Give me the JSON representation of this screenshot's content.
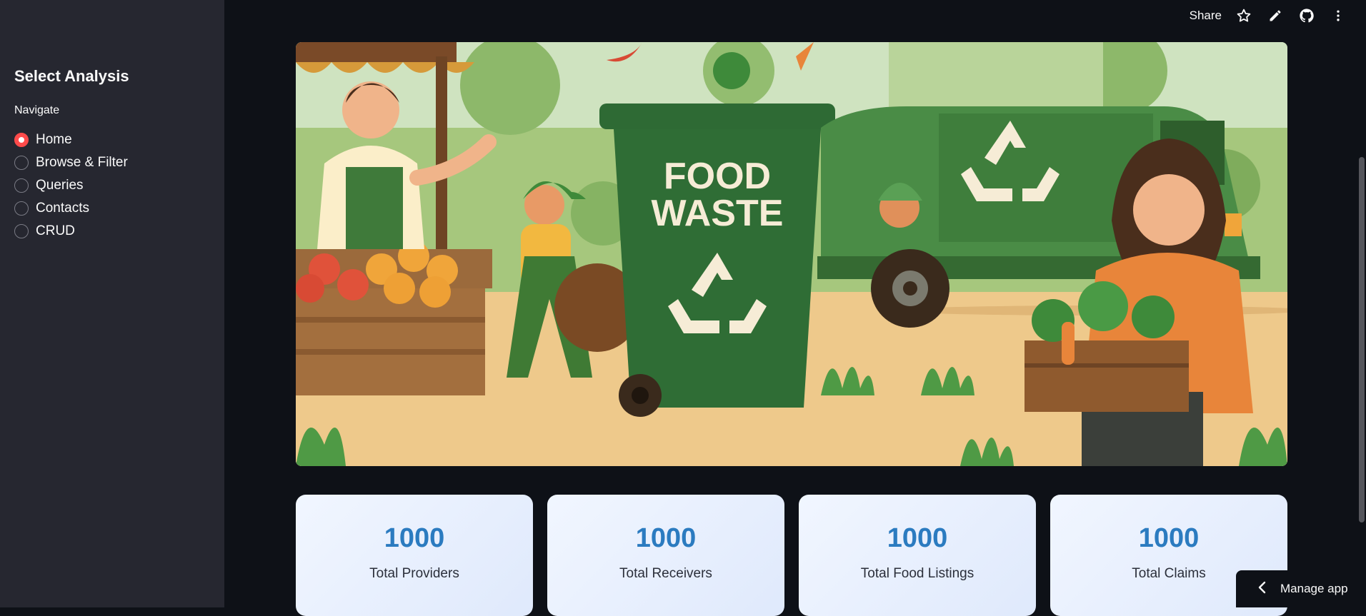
{
  "header": {
    "share_label": "Share",
    "icons": [
      "star-icon",
      "pencil-icon",
      "github-icon",
      "more-vertical-icon"
    ]
  },
  "sidebar": {
    "title": "Select Analysis",
    "nav_label": "Navigate",
    "selected": "Home",
    "items": [
      {
        "label": "Home"
      },
      {
        "label": "Browse & Filter"
      },
      {
        "label": "Queries"
      },
      {
        "label": "Contacts"
      },
      {
        "label": "CRUD"
      }
    ]
  },
  "hero": {
    "bin_text_line1": "FOOD",
    "bin_text_line2": "WASTE"
  },
  "metrics": [
    {
      "value": "1000",
      "label": "Total Providers"
    },
    {
      "value": "1000",
      "label": "Total Receivers"
    },
    {
      "value": "1000",
      "label": "Total Food Listings"
    },
    {
      "value": "1000",
      "label": "Total Claims"
    }
  ],
  "footer": {
    "manage_app_label": "Manage app"
  },
  "colors": {
    "sidebar_bg": "#262730",
    "main_bg": "#0e1117",
    "accent_radio": "#ff4b4b",
    "metric_value": "#2b7bc0"
  }
}
